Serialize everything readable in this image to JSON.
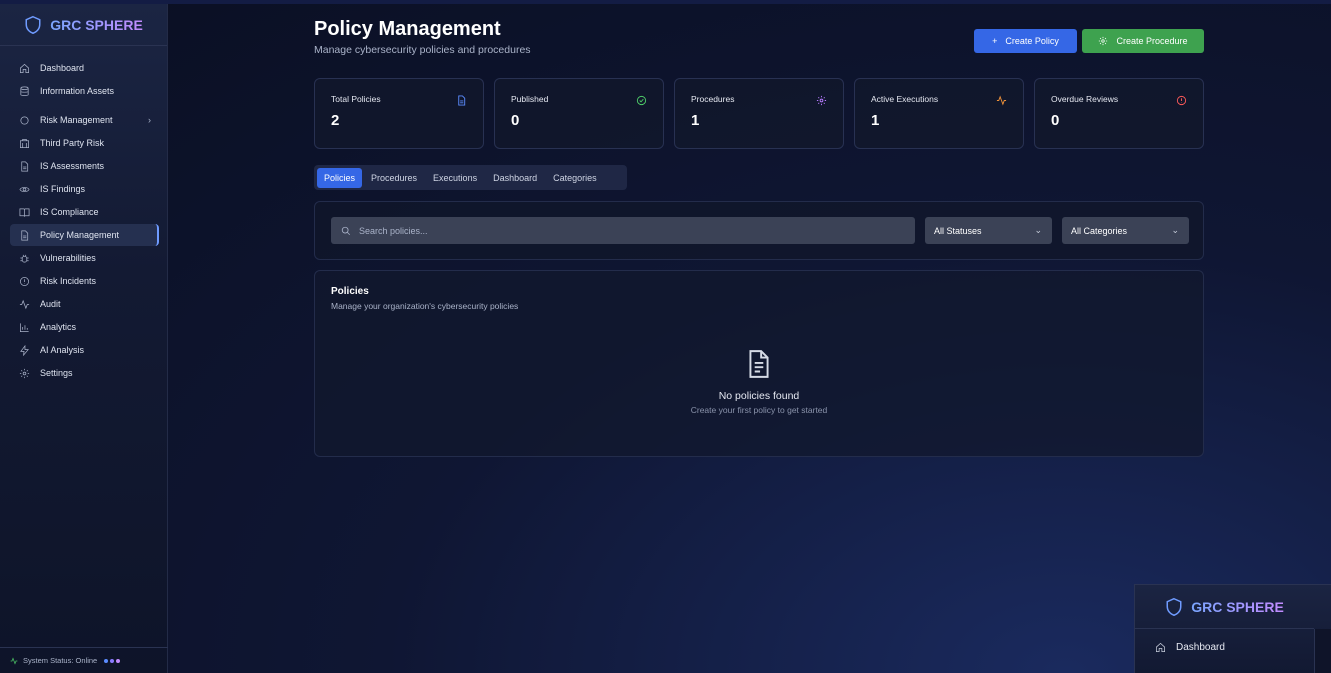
{
  "brand": {
    "name": "GRC SPHERE"
  },
  "sidebar": {
    "items": [
      {
        "label": "Dashboard",
        "icon": "home-icon"
      },
      {
        "label": "Information Assets",
        "icon": "database-icon"
      },
      {
        "label": "Risk Management",
        "icon": "circle-icon",
        "chevron": "›"
      },
      {
        "label": "Third Party Risk",
        "icon": "building-icon"
      },
      {
        "label": "IS Assessments",
        "icon": "file-icon"
      },
      {
        "label": "IS Findings",
        "icon": "eye-icon"
      },
      {
        "label": "IS Compliance",
        "icon": "book-icon"
      },
      {
        "label": "Policy Management",
        "icon": "file-text-icon",
        "active": true
      },
      {
        "label": "Vulnerabilities",
        "icon": "bug-icon"
      },
      {
        "label": "Risk Incidents",
        "icon": "alert-circle-icon"
      },
      {
        "label": "Audit",
        "icon": "activity-icon"
      },
      {
        "label": "Analytics",
        "icon": "bar-chart-icon"
      },
      {
        "label": "AI Analysis",
        "icon": "zap-icon"
      },
      {
        "label": "Settings",
        "icon": "gear-icon"
      }
    ],
    "status": "System Status: Online"
  },
  "header": {
    "title": "Policy Management",
    "subtitle": "Manage cybersecurity policies and procedures",
    "create_policy": "Create Policy",
    "create_procedure": "Create Procedure"
  },
  "stats": [
    {
      "label": "Total Policies",
      "value": "2",
      "icon": "file-icon",
      "color": "#5b8cff"
    },
    {
      "label": "Published",
      "value": "0",
      "icon": "check-circle-icon",
      "color": "#4fcf6a"
    },
    {
      "label": "Procedures",
      "value": "1",
      "icon": "gear-icon",
      "color": "#b77bff"
    },
    {
      "label": "Active Executions",
      "value": "1",
      "icon": "activity-icon",
      "color": "#f0923a"
    },
    {
      "label": "Overdue Reviews",
      "value": "0",
      "icon": "alert-circle-icon",
      "color": "#ff5a5a"
    }
  ],
  "tabs": [
    "Policies",
    "Procedures",
    "Executions",
    "Dashboard",
    "Categories"
  ],
  "filters": {
    "search_placeholder": "Search policies...",
    "status": "All Statuses",
    "category": "All Categories"
  },
  "policies_card": {
    "title": "Policies",
    "subtitle": "Manage your organization's cybersecurity policies",
    "empty_title": "No policies found",
    "empty_subtitle": "Create your first policy to get started"
  },
  "preview": {
    "brand": "GRC SPHERE",
    "item": "Dashboard"
  },
  "colors": {
    "accent": "#3567e6",
    "success": "#3ea24f"
  }
}
